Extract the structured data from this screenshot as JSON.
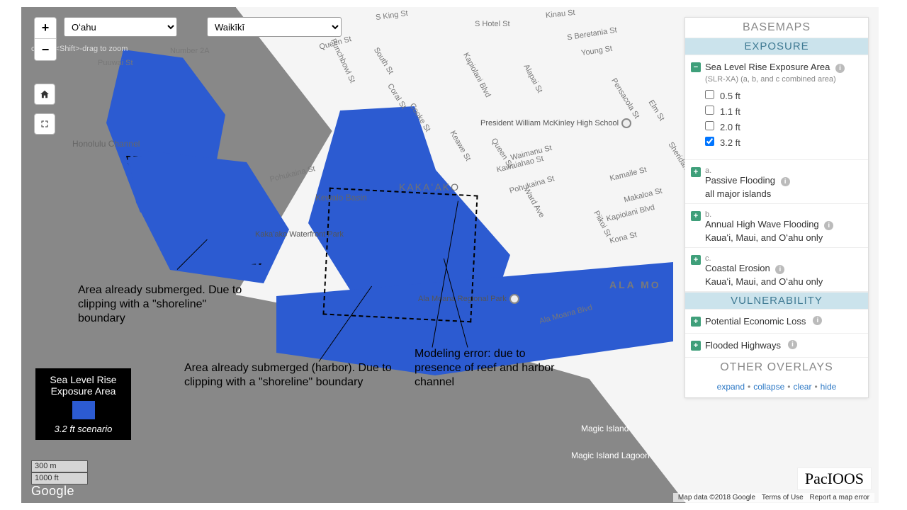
{
  "selectors": {
    "island": "Oʻahu",
    "region": "Waikīkī"
  },
  "zoom_hint": "or use <Shift>-drag to zoom",
  "map_labels": {
    "honolulu_channel": "Honolulu Channel",
    "kewalo_basin": "Kewalo Basin",
    "kakaako_park": "Kakaʻako Waterfront Park",
    "kakaako": "KAKAʻAKO",
    "ala_mo": "ALA MO",
    "regional_park": "Ala Moana Regional Park",
    "magic_island": "Magic Island",
    "magic_island_lagoon": "Magic Island Lagoon",
    "mckinley": "President William McKinley High School",
    "king_st": "S King St",
    "beretania": "S Beretania St",
    "hotel": "S Hotel St",
    "kinau": "Kinau St",
    "young": "Young St",
    "alapai": "Alapai St",
    "kapiolani": "Kapiolani Blvd",
    "piikoi": "Piikoi St",
    "elm": "Elm St",
    "pensacola": "Pensacola St",
    "sheridan": "Sheridan St",
    "kamaile": "Kamaile St",
    "kona": "Kona St",
    "makaloa": "Makaloa St",
    "queen": "Queen St",
    "south": "South St",
    "coral": "Coral St",
    "cooke": "Cooke St",
    "pohukaina": "Pohukaina St",
    "ward": "Ward Ave",
    "waimanu": "Waimanu St",
    "kawaiahao": "Kawaiahao St",
    "keawe": "Keawe St",
    "punchbowl": "Punchbowl St",
    "ala_moana_blvd": "Ala Moana Blvd",
    "puuwai": "Puuwai St",
    "number2a": "Number 2A"
  },
  "annotations": {
    "a1": "Area already submerged. Due to clipping with a \"shoreline\" boundary",
    "a2": "Area already submerged (harbor). Due to clipping with a \"shoreline\" boundary",
    "a3": "Modeling error: due to presence of reef and harbor channel"
  },
  "legend": {
    "title": "Sea Level Rise Exposure Area",
    "scenario": "3.2 ft scenario"
  },
  "scale": {
    "metric": "300 m",
    "imperial": "1000 ft"
  },
  "attribution": {
    "google": "Google",
    "data": "Map data ©2018 Google",
    "terms": "Terms of Use",
    "report": "Report a map error",
    "pacioos": "PacIOOS"
  },
  "panel": {
    "basemaps": "Basemaps",
    "exposure": "Exposure",
    "vulnerability": "Vulnerability",
    "other_overlays": "Other Overlays",
    "slrxa": {
      "title": "Sea Level Rise Exposure Area",
      "subtitle": "(SLR-XA) (a, b, and c combined area)",
      "levels": [
        "0.5 ft",
        "1.1 ft",
        "2.0 ft",
        "3.2 ft"
      ],
      "selected_index": 3
    },
    "sublayers": [
      {
        "prefix": "a.",
        "title": "Passive Flooding",
        "sub": "all major islands"
      },
      {
        "prefix": "b.",
        "title": "Annual High Wave Flooding",
        "sub": "Kauaʻi, Maui, and Oʻahu only"
      },
      {
        "prefix": "c.",
        "title": "Coastal Erosion",
        "sub": "Kauaʻi, Maui, and Oʻahu only"
      }
    ],
    "vuln_layers": [
      {
        "title": "Potential Economic Loss"
      },
      {
        "title": "Flooded Highways"
      }
    ],
    "footer": [
      "expand",
      "collapse",
      "clear",
      "hide"
    ]
  }
}
